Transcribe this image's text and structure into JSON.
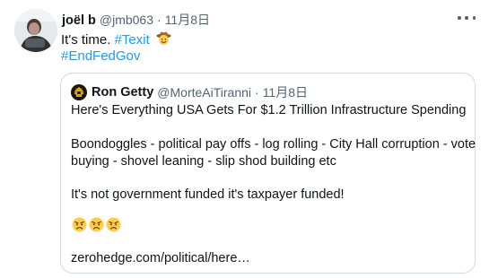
{
  "tweet": {
    "author_name": "joël b",
    "handle": "@jmb063",
    "separator": "·",
    "date": "11月8日",
    "text_prefix": "It's time.",
    "hashtag1": "#Texit",
    "emoji": "cowboy-hat-face",
    "hashtag2": "#EndFedGov",
    "more_icon": "more-horizontal-icon"
  },
  "quoted": {
    "author_name": "Ron Getty",
    "handle": "@MorteAiTiranni",
    "separator": "·",
    "date": "11月8日",
    "line1": "Here's Everything USA Gets For $1.2 Trillion Infrastructure Spending",
    "line2": "Boondoggles - political pay offs - log rolling - City Hall corruption - vote",
    "line3": "buying - shovel leaning - slip shod building etc",
    "line4": "It's not government funded it's taxpayer funded!",
    "emojis": [
      "angry-face",
      "angry-face",
      "angry-face"
    ],
    "link": "zerohedge.com/political/here…"
  },
  "colors": {
    "text": "#0f1419",
    "secondary": "#536471",
    "link": "#1d9bf0",
    "border": "#cfd9de"
  }
}
